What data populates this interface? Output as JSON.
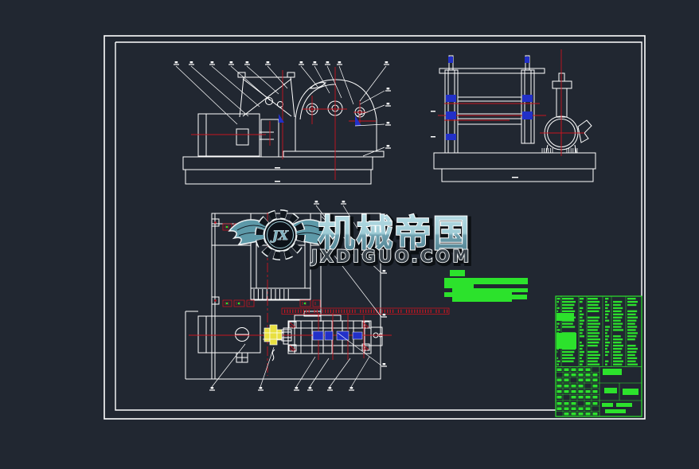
{
  "scene": {
    "background": "#212731"
  },
  "palette": {
    "drawing_line": "#ffffff",
    "centerline_red": "#c81420",
    "detail_blue": "#2230c8",
    "coupling_yellow": "#e8e040",
    "annotation_green": "#2ce22c"
  },
  "watermark": {
    "brand": "机械帝国",
    "site": "JXDIGUO.COM",
    "monogram": "JX",
    "brand_fill_top": "#b9dee6",
    "brand_fill_bottom": "#4f808f",
    "wing_color": "#5d99a8",
    "outline_color": "#eef3f4",
    "shadow_color": "#0c1014"
  }
}
